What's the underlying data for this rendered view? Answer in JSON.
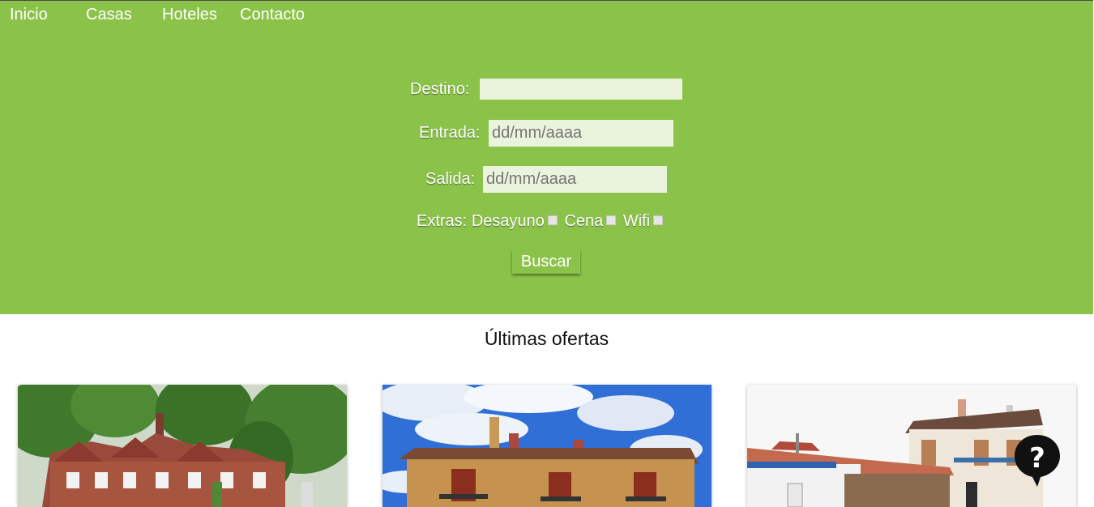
{
  "nav": {
    "items": [
      {
        "label": "Inicio"
      },
      {
        "label": "Casas"
      },
      {
        "label": "Hoteles"
      },
      {
        "label": "Contacto"
      }
    ]
  },
  "search": {
    "destino_label": "Destino:",
    "destino_value": "",
    "entrada_label": "Entrada:",
    "entrada_placeholder": "dd/mm/aaaa",
    "salida_label": "Salida:",
    "salida_placeholder": "dd/mm/aaaa",
    "extras_label": "Extras:",
    "extras": [
      {
        "label": "Desayuno",
        "checked": false
      },
      {
        "label": "Cena",
        "checked": false
      },
      {
        "label": "Wifi",
        "checked": false
      }
    ],
    "button_label": "Buscar"
  },
  "offers": {
    "title": "Últimas ofertas"
  },
  "colors": {
    "brand_green": "#8bc34a",
    "input_bg": "#eaf3dc"
  }
}
